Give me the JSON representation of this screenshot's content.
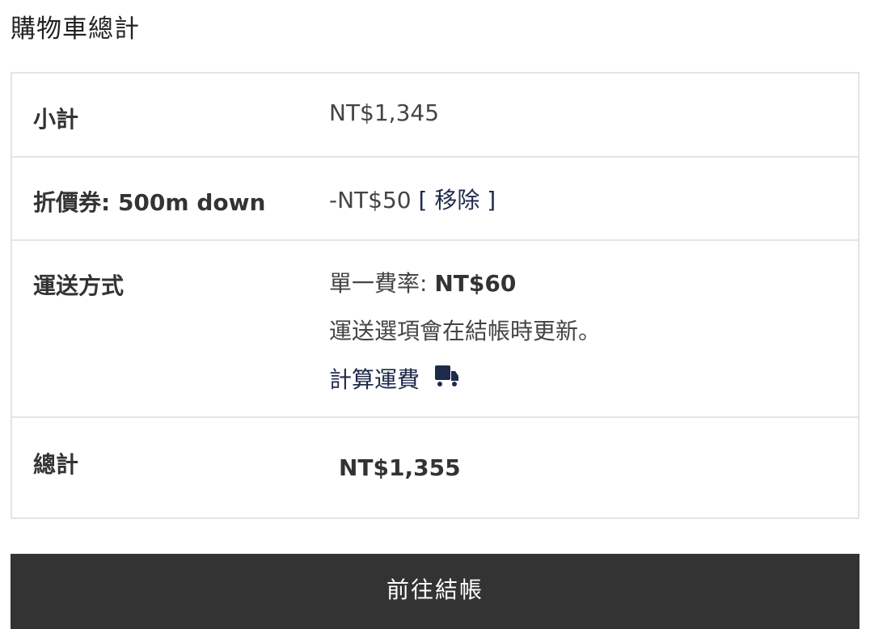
{
  "cart_totals": {
    "title": "購物車總計",
    "subtotal": {
      "label": "小計",
      "value": "NT$1,345"
    },
    "coupon": {
      "label": "折價券: 500m down",
      "value": "-NT$50",
      "remove_label": "[ 移除 ]"
    },
    "shipping": {
      "label": "運送方式",
      "rate_label": "單一費率: ",
      "rate_value": "NT$60",
      "note": "運送選項會在結帳時更新。",
      "calculate_label": "計算運費",
      "calculate_icon": "truck-icon"
    },
    "total": {
      "label": "總計",
      "value": "NT$1,355"
    }
  },
  "checkout": {
    "button_label": "前往結帳"
  },
  "colors": {
    "button_bg": "#333333",
    "link": "#1e2a4a",
    "border": "#e4e4e4"
  }
}
